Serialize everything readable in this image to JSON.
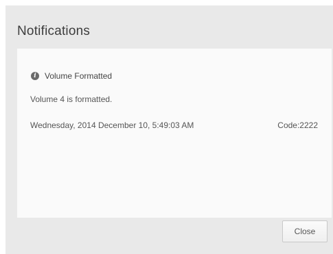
{
  "dialog": {
    "title": "Notifications",
    "close_label": "Close"
  },
  "notification": {
    "icon": "info-icon",
    "title": "Volume Formatted",
    "message": "Volume 4 is formatted.",
    "timestamp": "Wednesday, 2014 December 10, 5:49:03 AM",
    "code": "Code:2222"
  }
}
